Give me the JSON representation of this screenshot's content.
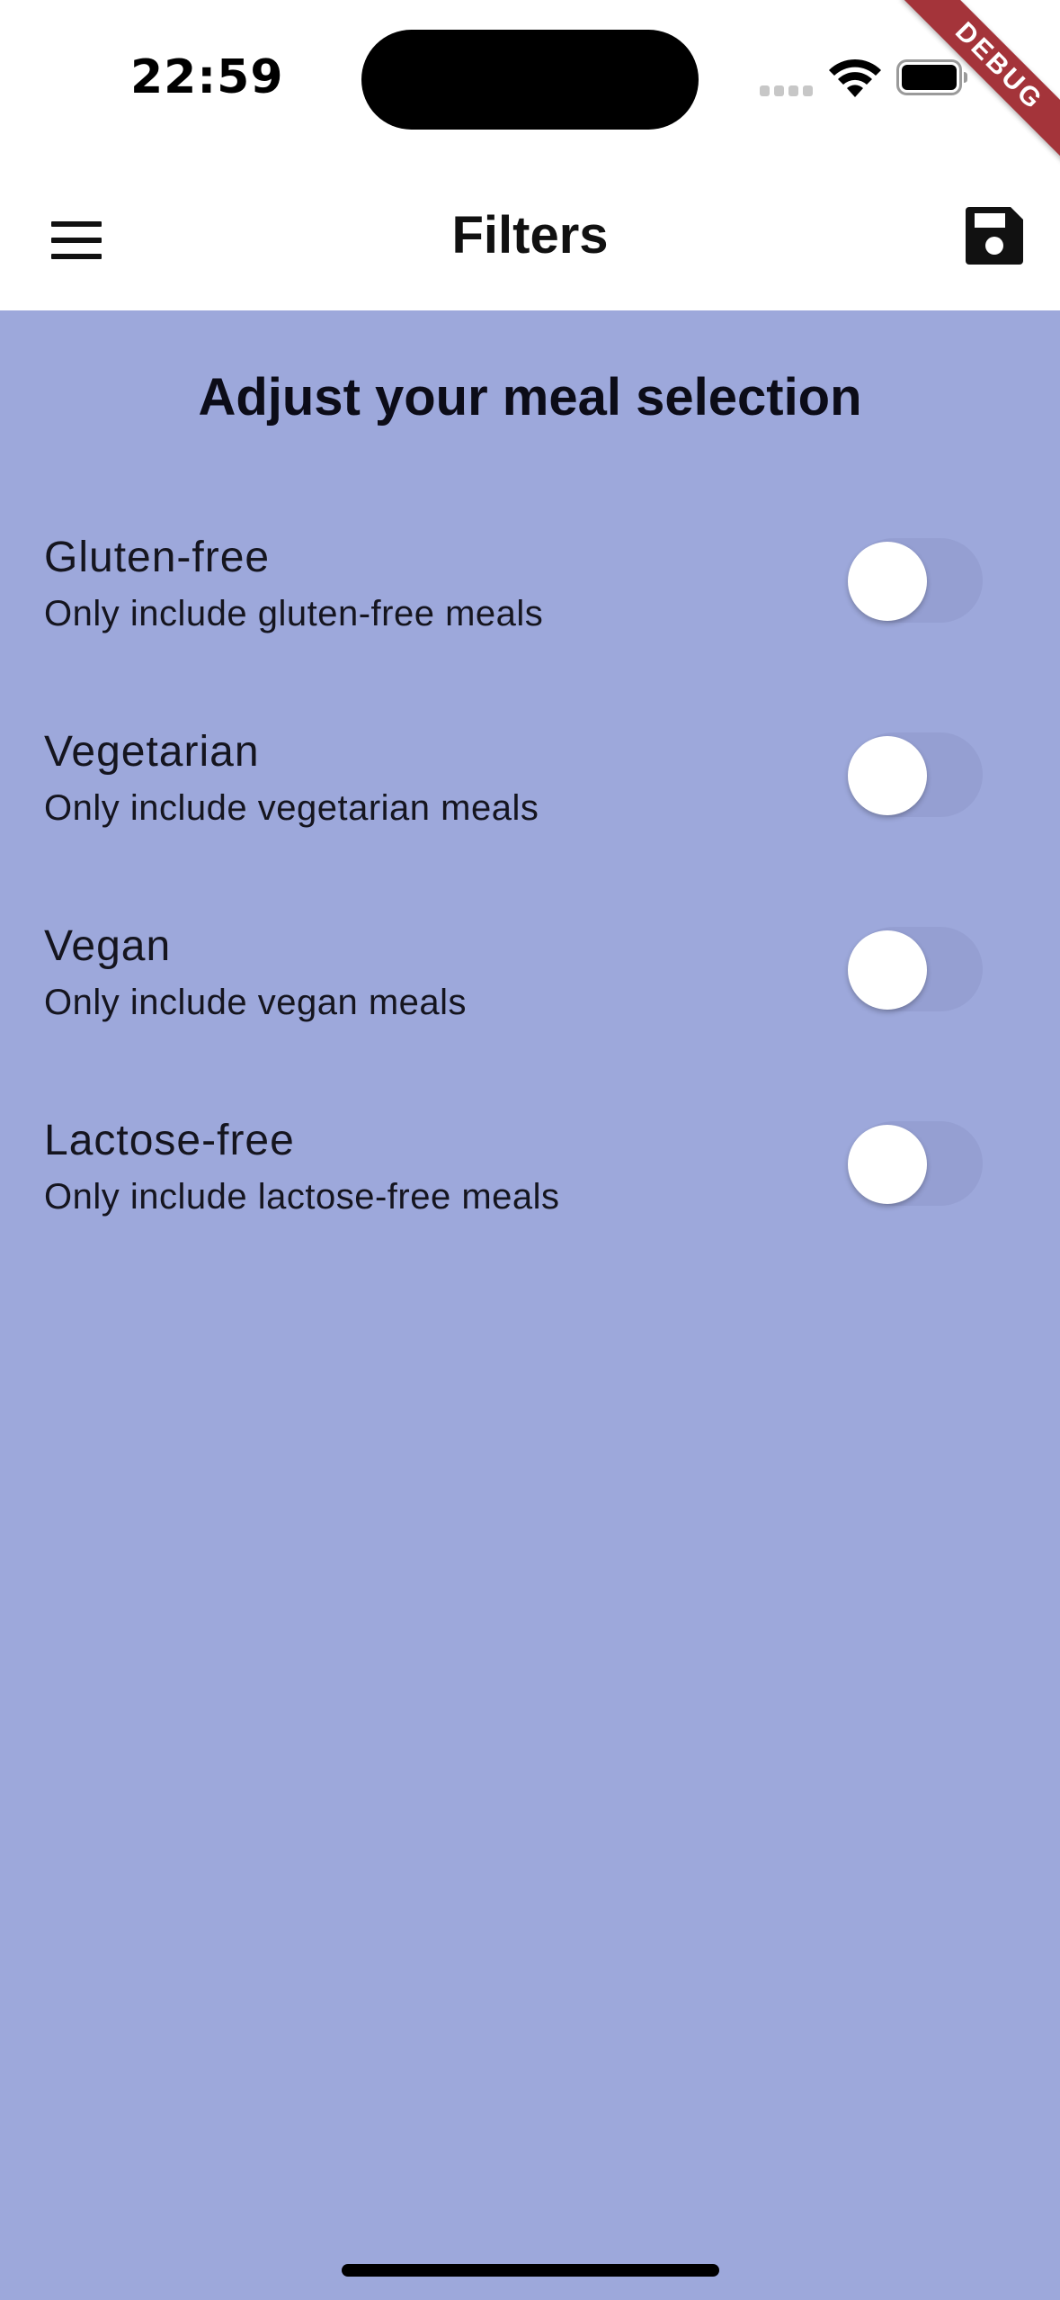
{
  "status_bar": {
    "time": "22:59"
  },
  "debug_banner": {
    "label": "DEBUG",
    "color": "#a4343a"
  },
  "app_bar": {
    "title": "Filters",
    "menu_icon": "hamburger-menu-icon",
    "save_icon": "floppy-disk-icon"
  },
  "main": {
    "heading": "Adjust your meal selection",
    "background_color": "#9da8db",
    "filters": [
      {
        "title": "Gluten-free",
        "subtitle": "Only include gluten-free meals",
        "enabled": false
      },
      {
        "title": "Vegetarian",
        "subtitle": "Only include vegetarian meals",
        "enabled": false
      },
      {
        "title": "Vegan",
        "subtitle": "Only include vegan meals",
        "enabled": false
      },
      {
        "title": "Lactose-free",
        "subtitle": "Only include lactose-free meals",
        "enabled": false
      }
    ]
  }
}
